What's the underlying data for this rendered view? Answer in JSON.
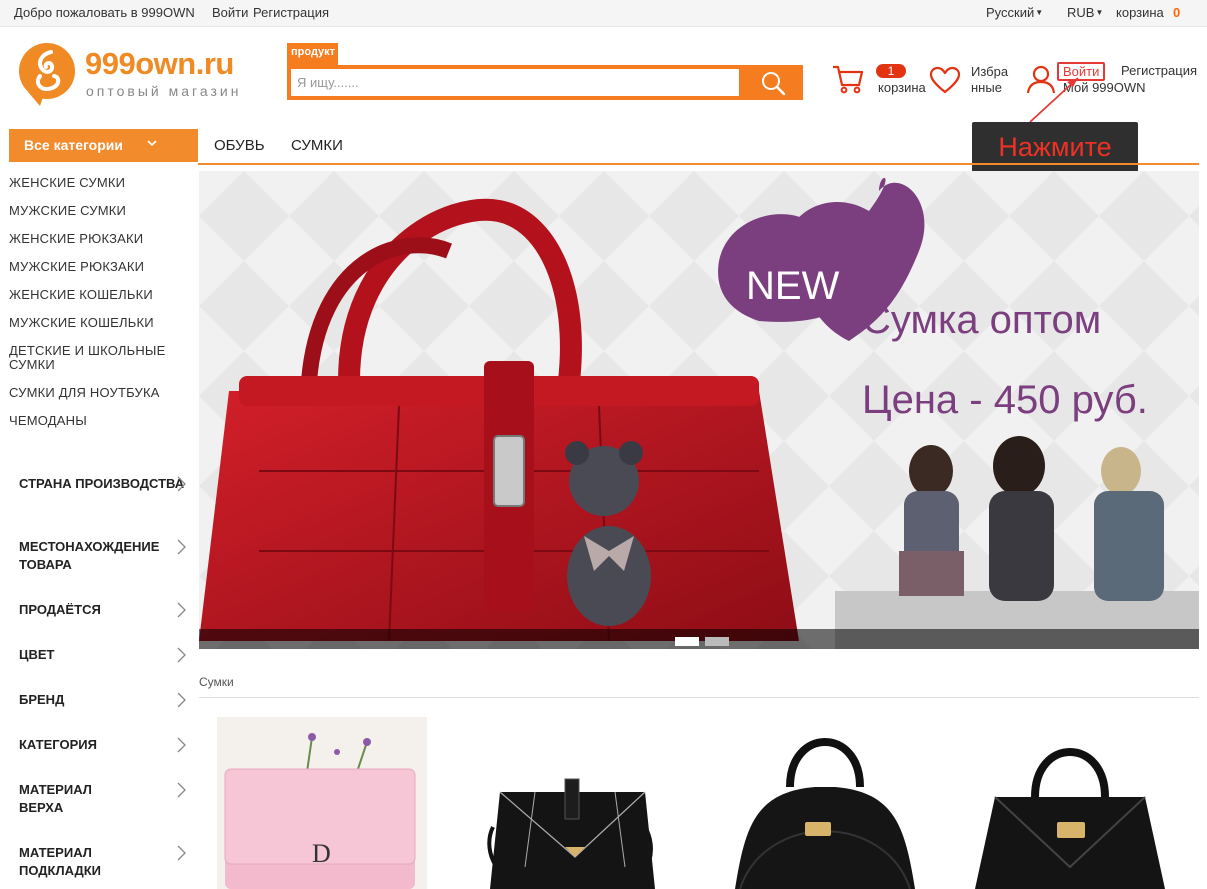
{
  "topbar": {
    "welcome": "Добро пожаловать в 999OWN",
    "login": "Войти",
    "register": "Регистрация",
    "language": "Русский",
    "currency": "RUB",
    "cart_label": "корзина",
    "cart_count": "0"
  },
  "header": {
    "logo_name": "999own.ru",
    "logo_sub": "оптовый магазин",
    "search_tab": "продукт",
    "search_placeholder": "Я ищу.......",
    "cart_badge": "1",
    "cart_label": "корзина",
    "favorites_label": "Избранные",
    "login": "Войти",
    "register": "Регистрация",
    "my_account": "Мой 999OWN",
    "tooltip": "Нажмите"
  },
  "nav": {
    "all_categories": "Все категории",
    "links": [
      "ОБУВЬ",
      "СУМКИ"
    ]
  },
  "sidebar": {
    "categories": [
      "ЖЕНСКИЕ СУМКИ",
      "МУЖСКИЕ СУМКИ",
      "ЖЕНСКИЕ РЮКЗАКИ",
      "МУЖСКИЕ РЮКЗАКИ",
      "ЖЕНСКИЕ КОШЕЛЬКИ",
      "МУЖСКИЕ КОШЕЛЬКИ",
      "ДЕТСКИЕ И ШКОЛЬНЫЕ СУМКИ",
      "СУМКИ ДЛЯ НОУТБУКА",
      "ЧЕМОДАНЫ"
    ],
    "filters": [
      "СТРАНА ПРОИЗВОДСТВА",
      "МЕСТОНАХОЖДЕНИЕ ТОВАРА",
      "ПРОДАЁТСЯ",
      "ЦВЕТ",
      "БРЕНД",
      "КАТЕГОРИЯ",
      "МАТЕРИАЛ ВЕРХА",
      "МАТЕРИАЛ ПОДКЛАДКИ"
    ]
  },
  "banner": {
    "badge": "NEW",
    "headline": "Сумка оптом",
    "price": "Цена - 450 руб.",
    "slide_count": 2,
    "active_slide": 1
  },
  "section": {
    "breadcrumb": "Сумки"
  },
  "colors": {
    "accent": "#f28b2c",
    "search": "#f57c1f",
    "alert": "#e53935",
    "banner_text": "#7b3f7f"
  }
}
